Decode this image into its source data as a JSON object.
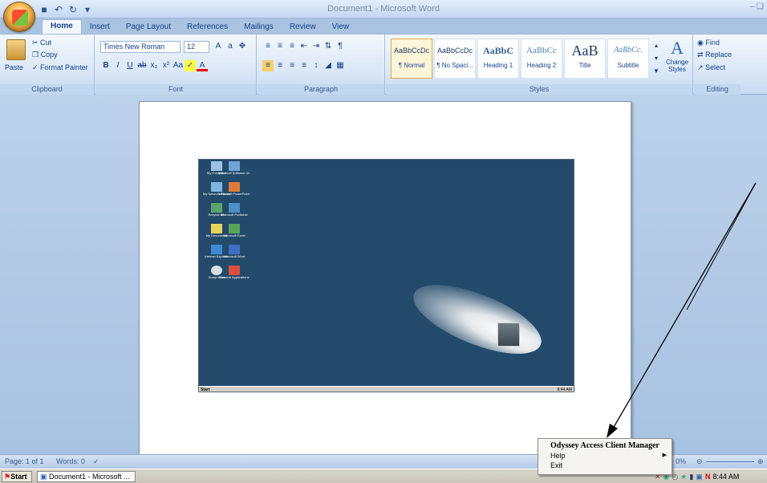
{
  "window": {
    "title": "Document1 - Microsoft Word",
    "controls": "– ❑"
  },
  "quick_access": {
    "icons": [
      "save-icon",
      "undo-icon",
      "redo-icon",
      "customize-icon"
    ]
  },
  "tabs": [
    "Home",
    "Insert",
    "Page Layout",
    "References",
    "Mailings",
    "Review",
    "View"
  ],
  "ribbon": {
    "clipboard": {
      "paste": "Paste",
      "cut": "Cut",
      "copy": "Copy",
      "format_painter": "Format Painter",
      "label": "Clipboard"
    },
    "font": {
      "name": "Times New Roman",
      "size": "12",
      "label": "Font"
    },
    "paragraph": {
      "label": "Paragraph"
    },
    "styles": {
      "items": [
        {
          "sample": "AaBbCcDc",
          "name": "¶ Normal"
        },
        {
          "sample": "AaBbCcDc",
          "name": "¶ No Spaci..."
        },
        {
          "sample": "AaBbC",
          "name": "Heading 1"
        },
        {
          "sample": "AaBbCc",
          "name": "Heading 2"
        },
        {
          "sample": "AaB",
          "name": "Title"
        },
        {
          "sample": "AaBbCc.",
          "name": "Subtitle"
        }
      ],
      "change_styles": "Change Styles",
      "label": "Styles"
    },
    "editing": {
      "find": "Find",
      "replace": "Replace",
      "select": "Select",
      "label": "Editing"
    }
  },
  "inner_desktop": {
    "icons": [
      "My Computer",
      "Microsoft Software Ut.",
      "My Network Places",
      "Microsoft PowerPoint",
      "Recycle Bin",
      "Microsoft Publisher",
      "My Documents",
      "Microsoft Excel",
      "Internet Explorer",
      "Microsoft Word",
      "Group Wise",
      "Network Applications"
    ],
    "start": "Start",
    "time": "8:44 AM"
  },
  "statusbar": {
    "page": "Page: 1 of 1",
    "words": "Words: 0",
    "zoom": "0%"
  },
  "taskbar": {
    "start": "Start",
    "document": "Document1 - Microsoft ...",
    "time": "8:44 AM"
  },
  "context_menu": {
    "items": [
      "Odyssey Access Client Manager",
      "Help",
      "Exit"
    ]
  }
}
